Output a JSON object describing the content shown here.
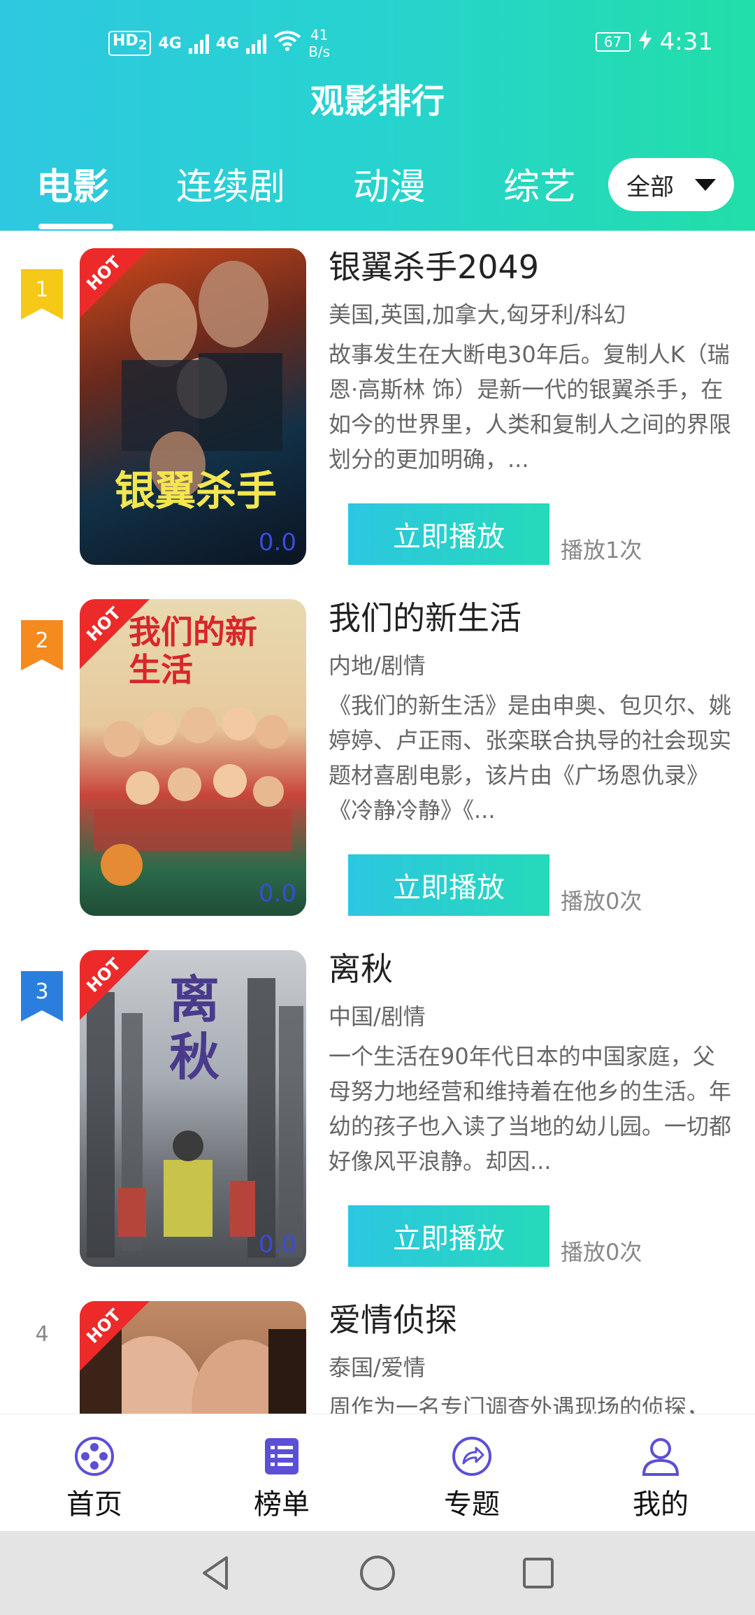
{
  "status_bar": {
    "hd_label": "HD",
    "hd_sub": "2",
    "net1": "4G",
    "net2": "4G",
    "speed_value": "41",
    "speed_unit": "B/s",
    "battery": "67",
    "time": "4:31"
  },
  "header": {
    "title": "观影排行",
    "tabs": [
      {
        "label": "电影",
        "active": true
      },
      {
        "label": "连续剧",
        "active": false
      },
      {
        "label": "动漫",
        "active": false
      },
      {
        "label": "综艺",
        "active": false
      }
    ],
    "filter": {
      "selected": "全部"
    }
  },
  "list": {
    "items": [
      {
        "rank": "1",
        "rank_color": "#f6c818",
        "badge": "HOT",
        "poster_text": "银翼杀手",
        "score": "0.0",
        "title": "银翼杀手2049",
        "genre": "美国,英国,加拿大,匈牙利/科幻",
        "desc": "故事发生在大断电30年后。复制人K（瑞恩·高斯林 饰）是新一代的银翼杀手，在如今的世界里，人类和复制人之间的界限划分的更加明确，...",
        "play_label": "立即播放",
        "plays": "播放1次"
      },
      {
        "rank": "2",
        "rank_color": "#f58a1f",
        "badge": "HOT",
        "poster_text": "我们的新生活",
        "score": "0.0",
        "title": "我们的新生活",
        "genre": "内地/剧情",
        "desc": "《我们的新生活》是由申奥、包贝尔、姚婷婷、卢正雨、张栾联合执导的社会现实题材喜剧电影，该片由《广场恩仇录》《冷静冷静》《...",
        "play_label": "立即播放",
        "plays": "播放0次"
      },
      {
        "rank": "3",
        "rank_color": "#2a7fde",
        "badge": "HOT",
        "poster_text": "离秋",
        "score": "0.0",
        "title": "离秋",
        "genre": "中国/剧情",
        "desc": "一个生活在90年代日本的中国家庭，父母努力地经营和维持着在他乡的生活。年幼的孩子也入读了当地的幼儿园。一切都好像风平浪静。却因...",
        "play_label": "立即播放",
        "plays": "播放0次"
      },
      {
        "rank": "4",
        "rank_color": "",
        "badge": "HOT",
        "poster_text": "",
        "score": "",
        "title": "爱情侦探",
        "genre": "泰国/爱情",
        "desc": "周作为一名专门调查外遇现场的侦探，",
        "play_label": "",
        "plays": ""
      }
    ]
  },
  "bottom_nav": {
    "items": [
      {
        "label": "首页",
        "icon": "film-reel-icon"
      },
      {
        "label": "榜单",
        "icon": "list-icon"
      },
      {
        "label": "专题",
        "icon": "share-arrow-icon"
      },
      {
        "label": "我的",
        "icon": "user-icon"
      }
    ]
  },
  "colors": {
    "accent_start": "#2ec8e0",
    "accent_end": "#22dea8",
    "nav_icon": "#5b4fd6",
    "hot": "#ec2a2a"
  }
}
